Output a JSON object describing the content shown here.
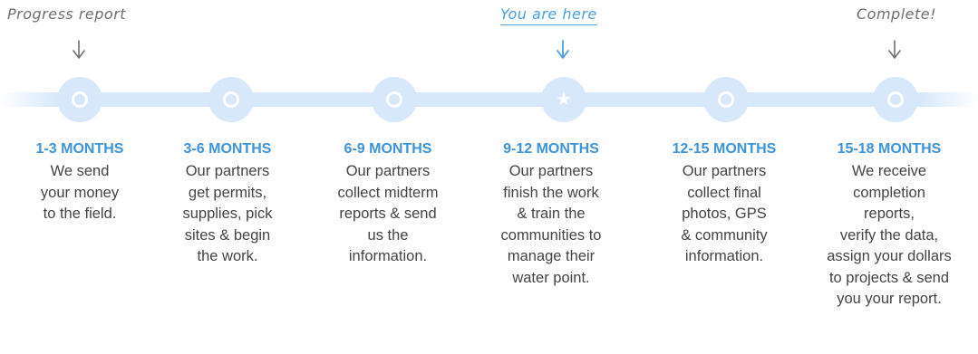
{
  "annotations": {
    "progress_report": "Progress report",
    "you_are_here": "You are here",
    "complete": "Complete!"
  },
  "colors": {
    "accent": "#3d94d9",
    "track": "#d6e8fa",
    "note_gray": "#6f6f6f",
    "body_text": "#444444"
  },
  "current_stage": "9-12 MONTHS",
  "stages": [
    {
      "label": "1-3 MONTHS",
      "description": "We send\nyour money\nto the field.",
      "icon": "dot-icon"
    },
    {
      "label": "3-6 MONTHS",
      "description": "Our partners\nget permits,\nsupplies, pick\nsites & begin\nthe work.",
      "icon": "dot-icon"
    },
    {
      "label": "6-9 MONTHS",
      "description": "Our partners\ncollect midterm\nreports & send\nus the\ninformation.",
      "icon": "dot-icon"
    },
    {
      "label": "9-12 MONTHS",
      "description": "Our partners\nfinish the work\n& train the\ncommunities to\nmanage their\nwater point.",
      "icon": "star-icon"
    },
    {
      "label": "12-15 MONTHS",
      "description": "Our partners\ncollect final\nphotos, GPS\n& community\ninformation.",
      "icon": "dot-icon"
    },
    {
      "label": "15-18 MONTHS",
      "description": "We receive\ncompletion\nreports,\nverify the data,\nassign your dollars\nto projects & send\nyou your report.",
      "icon": "dot-icon"
    }
  ]
}
